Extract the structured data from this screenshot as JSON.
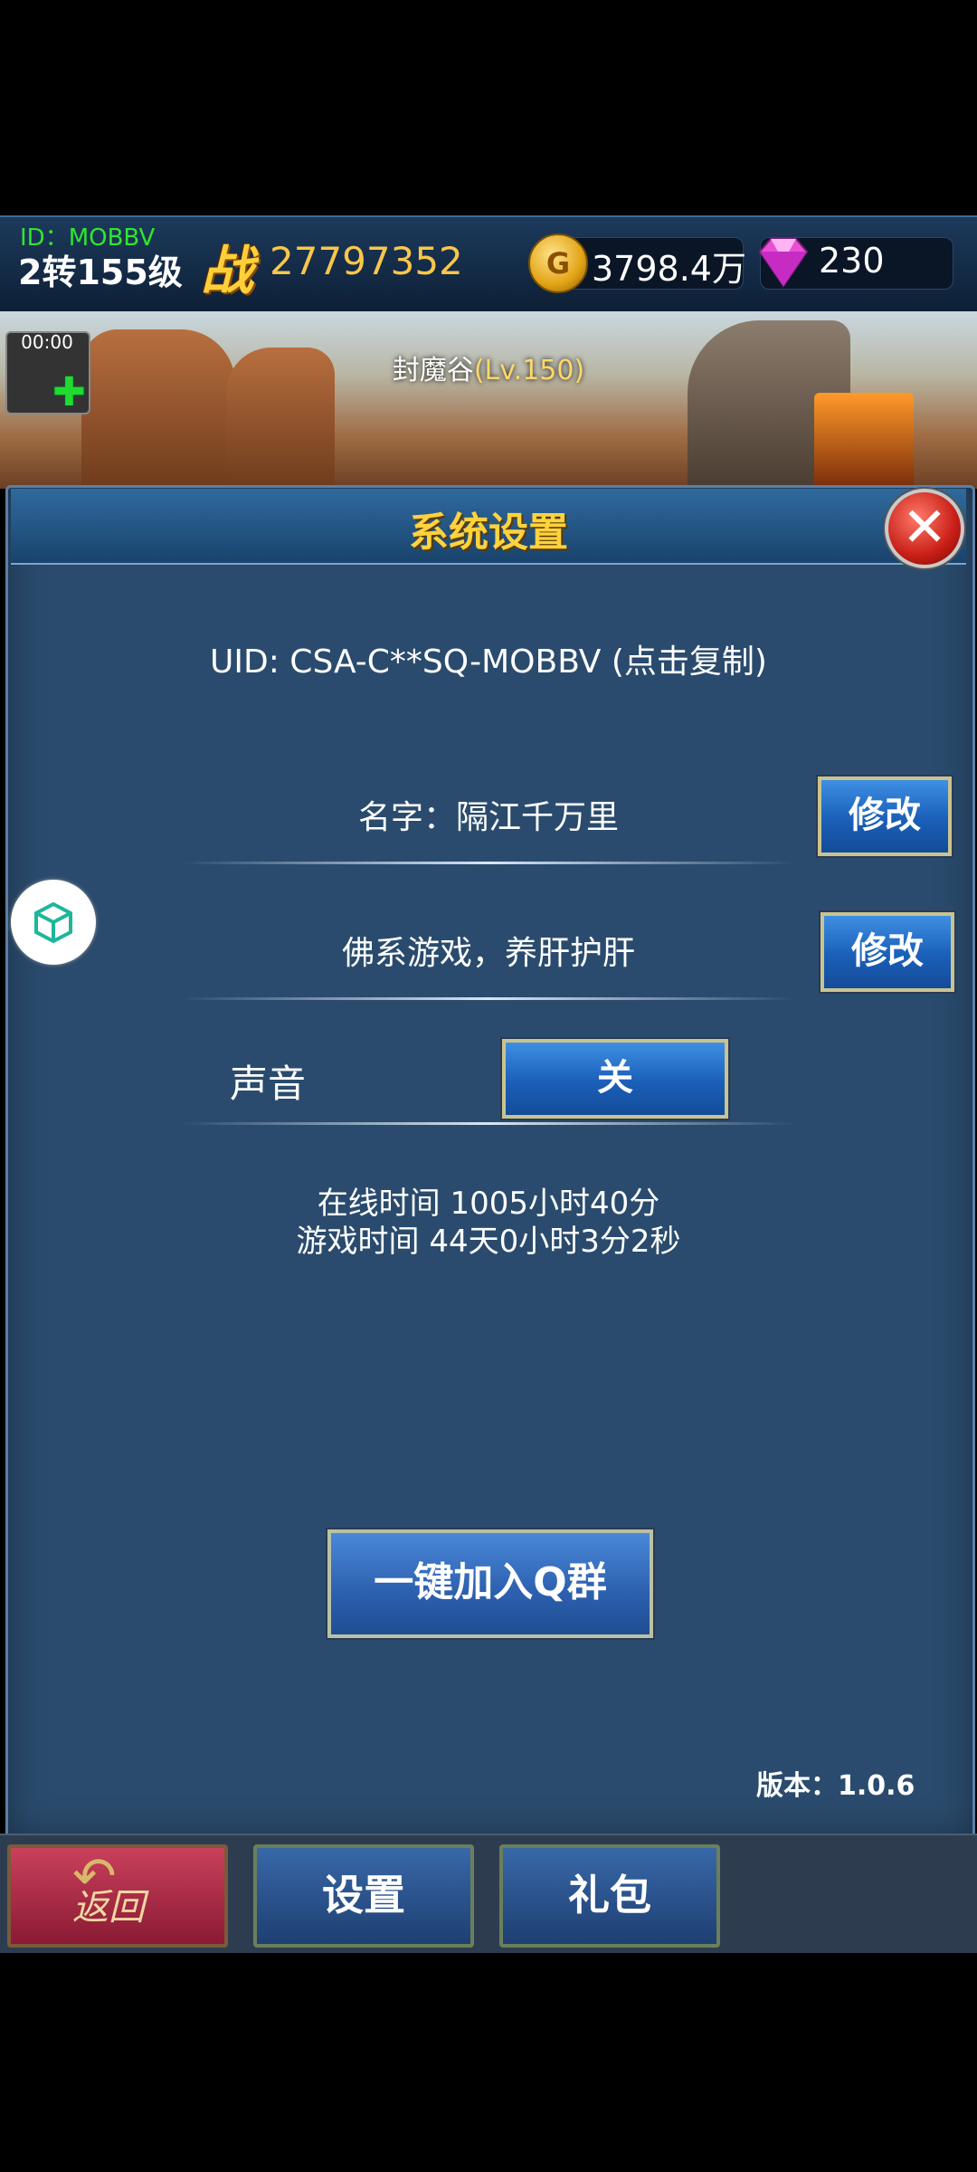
{
  "topbar": {
    "player_id": "ID：MOBBV",
    "level": "2转155级",
    "combat_icon_text": "战",
    "combat_power": "27797352",
    "gold_icon_text": "G",
    "gold": "3798.4万",
    "gems": "230"
  },
  "banner": {
    "map_name": "封魔谷",
    "map_level": "(Lv.150)",
    "timer": "00:00",
    "plus_icon": "plus-icon"
  },
  "panel": {
    "title": "系统设置",
    "close_icon": "✕",
    "uid_text": "UID: CSA-C**SQ-MOBBV (点击复制)",
    "name_label": "名字：隔江千万里",
    "rename_label": "修改",
    "motto": "佛系游戏，养肝护肝",
    "motto_edit_label": "修改",
    "sound_label": "声音",
    "sound_value": "关",
    "online_time": "在线时间 1005小时40分",
    "play_time": "游戏时间 44天0小时3分2秒",
    "join_qq_label": "一键加入Q群",
    "version": "版本：1.0.6"
  },
  "bottom_nav": {
    "back_label": "返回",
    "back_glyph": "↶",
    "settings_label": "设置",
    "gift_label": "礼包"
  },
  "colors": {
    "accent_gold": "#ffd23e",
    "panel_bg": "#2a4b6d",
    "button_blue": "#1a5fb8",
    "id_green": "#2fe62f"
  }
}
